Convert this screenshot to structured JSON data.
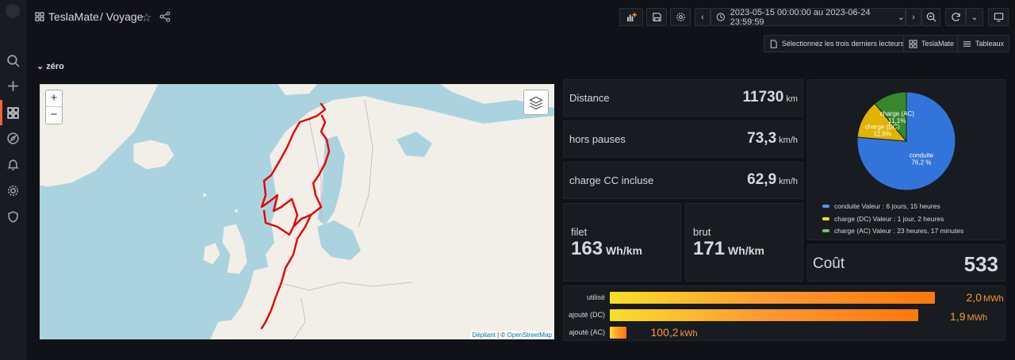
{
  "sidebar": {
    "items": [
      "search-icon",
      "plus-icon",
      "dashboards-icon",
      "explore-icon",
      "alert-icon",
      "gear-icon",
      "shield-icon"
    ]
  },
  "breadcrumb": {
    "root": "TeslaMate",
    "page": "/ Voyage"
  },
  "toolbar": {
    "time_range": "2023-05-15 00:00:00 au 2023-06-24 23:59:59"
  },
  "links": {
    "select_last": "Sélectionnez les trois derniers lecteurs",
    "teslamate": "TeslaMate",
    "tableaux": "Tableaux"
  },
  "row": {
    "title": "zéro"
  },
  "map": {
    "zoom_in": "+",
    "zoom_out": "−",
    "attribution_a": "Dépliant",
    "attribution_sep": " | © ",
    "attribution_b": "OpenStreetMap"
  },
  "stats": {
    "distance": {
      "label": "Distance",
      "value": "11730",
      "unit": "km"
    },
    "hors_pauses": {
      "label": "hors pauses",
      "value": "73,3",
      "unit": "km/h"
    },
    "charge_cc": {
      "label": "charge CC incluse",
      "value": "62,9",
      "unit": "km/h"
    },
    "filet": {
      "label": "filet",
      "value": "163",
      "unit": "Wh/km"
    },
    "brut": {
      "label": "brut",
      "value": "171",
      "unit": "Wh/km"
    },
    "cout": {
      "label": "Coût",
      "value": "533"
    }
  },
  "pie": {
    "slices": [
      {
        "name": "conduite",
        "label": "conduite",
        "pct": "76,2 %",
        "value": 76.2,
        "color": "#3274d9",
        "legend": "conduite  Valeur : 6 jours, 15 heures"
      },
      {
        "name": "charge (DC)",
        "label": "charge (DC)",
        "pct": "12,6%",
        "value": 12.6,
        "color": "#e0b400",
        "legend": "charge (DC)  Valeur : 1 jour, 2 heures"
      },
      {
        "name": "charge (AC)",
        "label": "charge (AC)",
        "pct": "11,1%",
        "value": 11.1,
        "color": "#37872d",
        "legend": "charge (AC)  Valeur : 23 heures, 17 minutes"
      }
    ]
  },
  "energy": {
    "max": 2.2,
    "rows": [
      {
        "label": "utilisé",
        "display": "2,0",
        "unit": "MWh",
        "value": 2.0
      },
      {
        "label": "ajouté (DC)",
        "display": "1,9",
        "unit": "MWh",
        "value": 1.9
      },
      {
        "label": "ajouté (AC)",
        "display": "100,2",
        "unit": "kWh",
        "value": 0.1002
      }
    ]
  },
  "colors": {
    "accent": "#f55f3e",
    "orange": "#ff9830",
    "bg": "#111217",
    "panel": "#181b1f"
  }
}
